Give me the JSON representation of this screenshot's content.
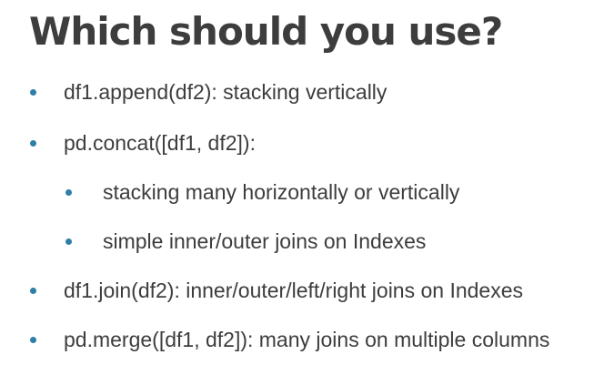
{
  "slide": {
    "title": "Which should you use?",
    "bullets": [
      {
        "level": 1,
        "text": "df1.append(df2): stacking vertically"
      },
      {
        "level": 1,
        "text": "pd.concat([df1, df2]):"
      },
      {
        "level": 2,
        "text": "stacking many horizontally or vertically"
      },
      {
        "level": 2,
        "text": "simple inner/outer joins on Indexes"
      },
      {
        "level": 1,
        "text": "df1.join(df2): inner/outer/left/right joins on Indexes"
      },
      {
        "level": 1,
        "text": "pd.merge([df1, df2]): many joins on multiple columns"
      }
    ]
  },
  "colors": {
    "bullet_dot": "#2e7fa6",
    "text": "#3d3d3d",
    "background": "#ffffff"
  }
}
